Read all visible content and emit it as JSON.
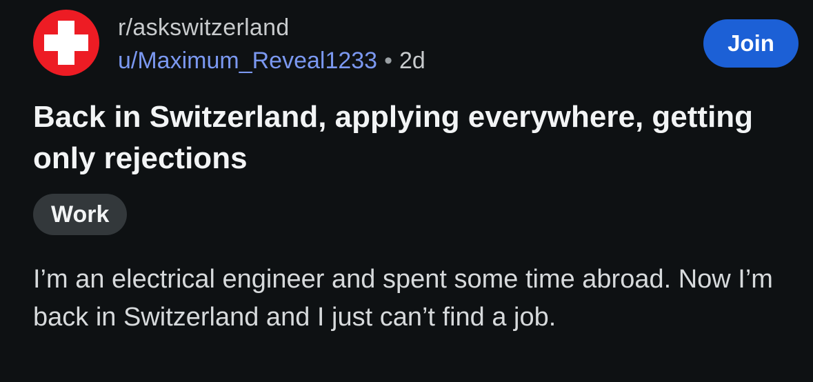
{
  "post": {
    "subreddit": "r/askswitzerland",
    "author": "u/Maximum_Reveal1233",
    "separator": "•",
    "age": "2d",
    "join_label": "Join",
    "title": "Back in Switzerland, applying everywhere, getting only rejections",
    "flair": "Work",
    "body": "I’m an electrical engineer and spent some time abroad. Now I’m back in Switzerland and I just can’t find a job."
  },
  "icons": {
    "avatar": "swiss-flag-icon"
  },
  "colors": {
    "background": "#0e1113",
    "join_button": "#1c60d6",
    "username": "#7b98f0",
    "flair_bg": "#33383b",
    "avatar_red": "#ed1c24"
  }
}
